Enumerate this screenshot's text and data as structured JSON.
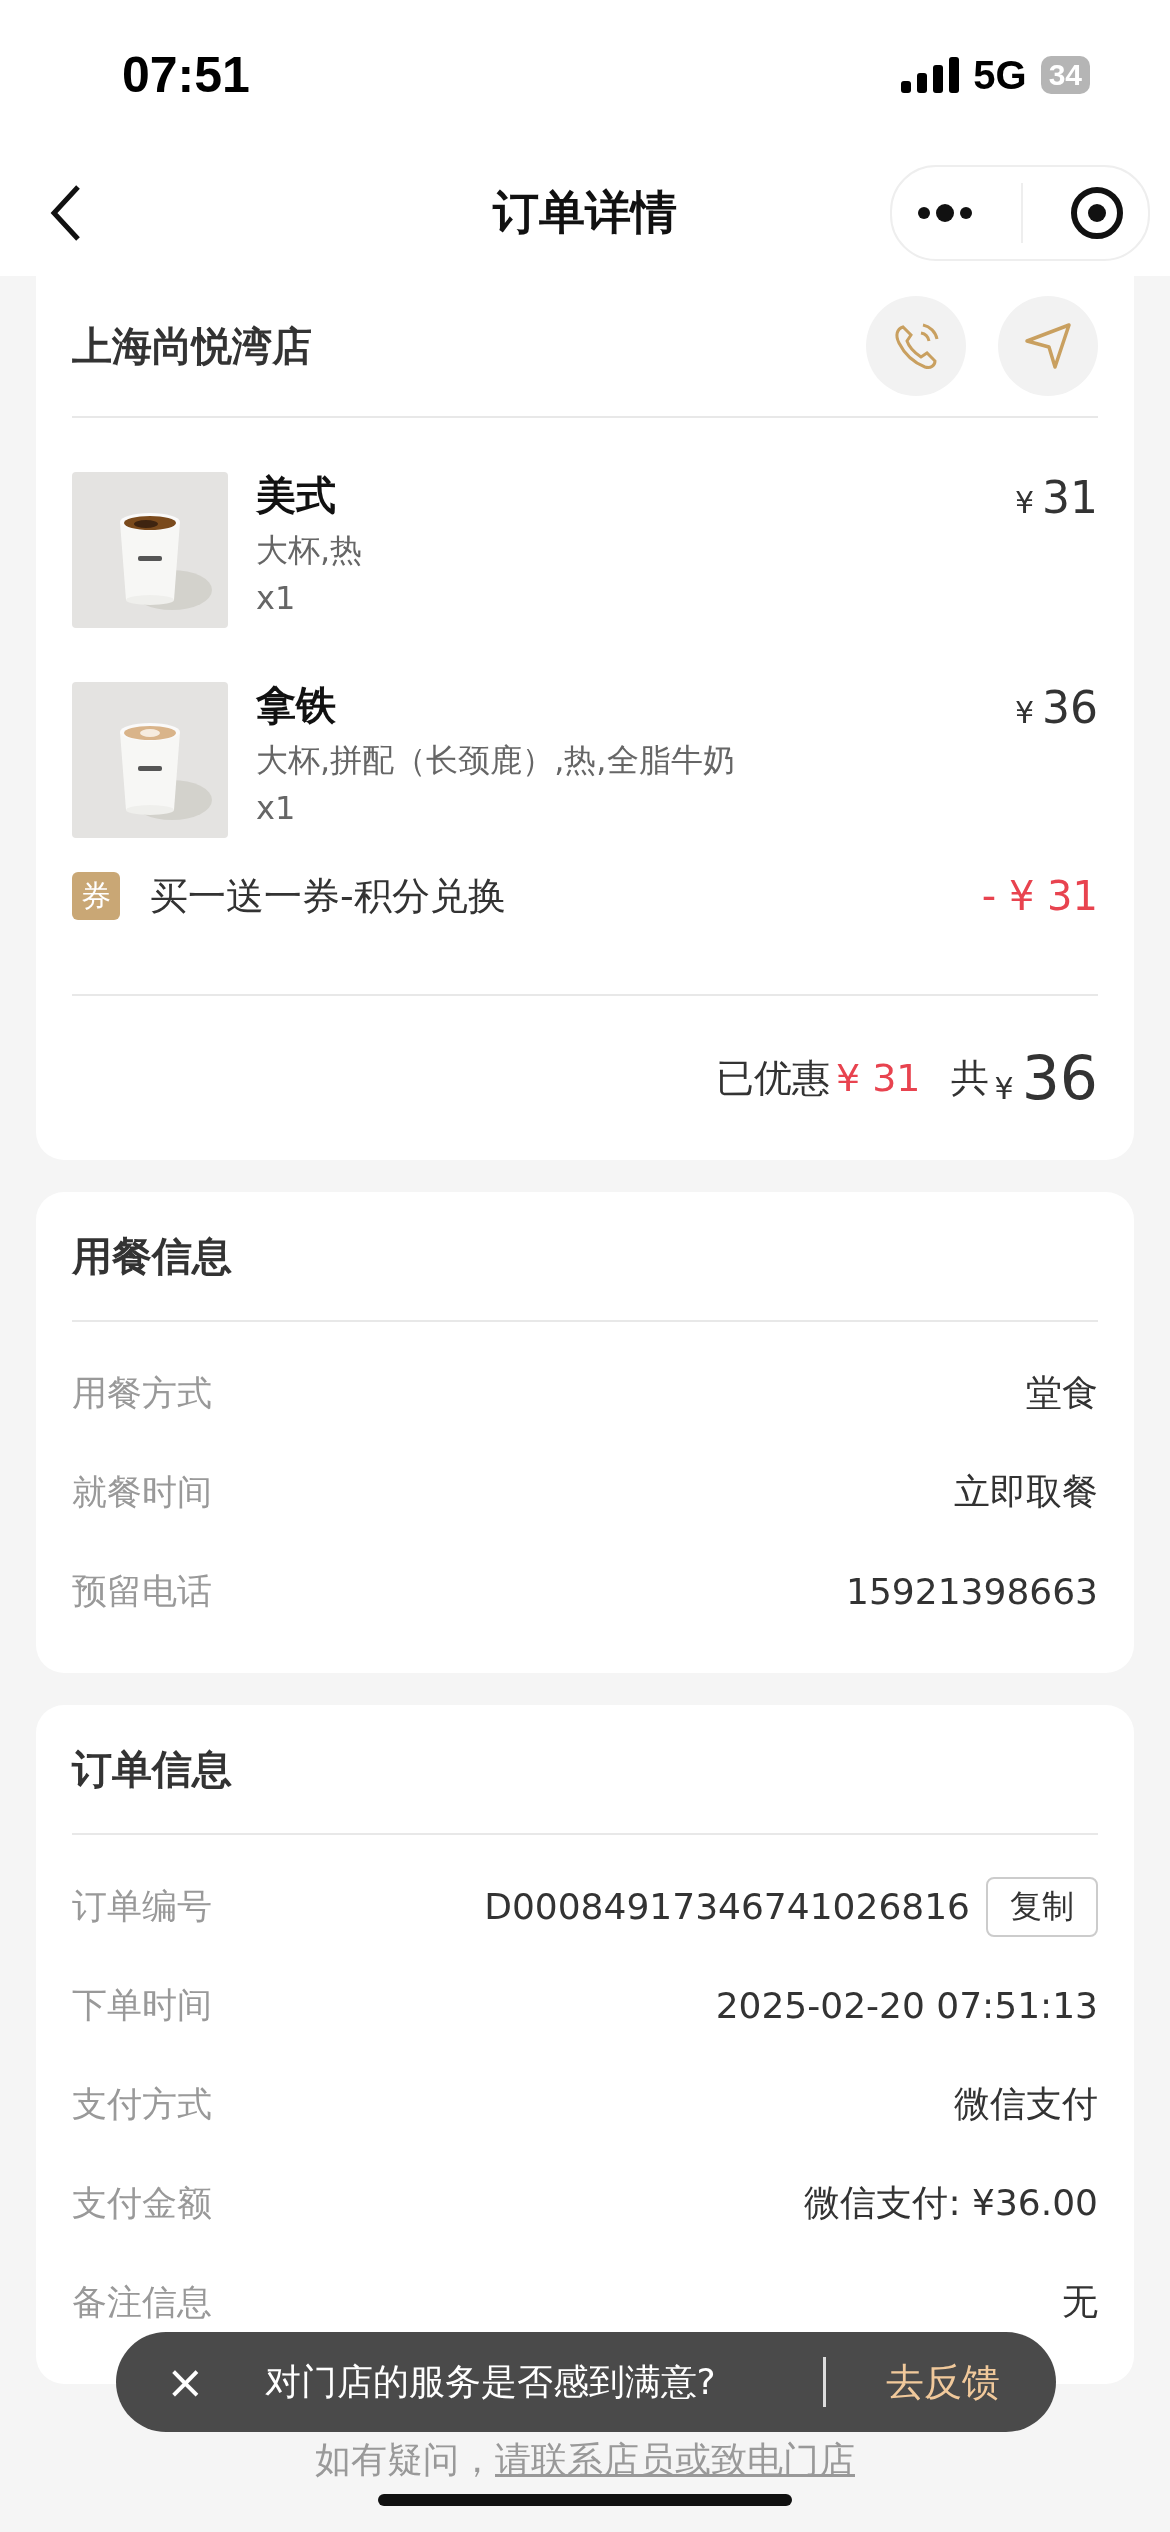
{
  "status_bar": {
    "time": "07:51",
    "network": "5G",
    "battery": "34"
  },
  "nav": {
    "title": "订单详情"
  },
  "store": {
    "name": "上海尚悦湾店"
  },
  "items": [
    {
      "name": "美式",
      "spec": "大杯,热",
      "qty": "x1",
      "currency": "¥",
      "price": "31",
      "kind": "picture"
    },
    {
      "name": "拿铁",
      "spec": "大杯,拼配（长颈鹿）,热,全脂牛奶",
      "qty": "x1",
      "currency": "¥",
      "price": "36",
      "kind": "picture"
    }
  ],
  "coupon": {
    "badge": "券",
    "label": "买一送一券-积分兑换",
    "sign": "-",
    "currency": "¥",
    "amount": "31"
  },
  "summary": {
    "discount_label": "已优惠",
    "discount_currency": "¥",
    "discount": "31",
    "total_label": "共",
    "total_currency": "¥",
    "total": "36"
  },
  "dining": {
    "title": "用餐信息",
    "rows": [
      {
        "label": "用餐方式",
        "value": "堂食",
        "kind": "text"
      },
      {
        "label": "就餐时间",
        "value": "立即取餐",
        "kind": "text"
      },
      {
        "label": "预留电话",
        "value": "15921398663",
        "kind": "text"
      }
    ]
  },
  "order": {
    "title": "订单信息",
    "rows": [
      {
        "label": "订单编号",
        "value": "D00084917346741026816",
        "kind": "copy",
        "button": "复制"
      },
      {
        "label": "下单时间",
        "value": "2025-02-20 07:51:13",
        "kind": "text"
      },
      {
        "label": "支付方式",
        "value": "微信支付",
        "kind": "text"
      },
      {
        "label": "支付金额",
        "value": "微信支付: ¥36.00",
        "kind": "text"
      },
      {
        "label": "备注信息",
        "value": "无",
        "kind": "text"
      }
    ]
  },
  "toast": {
    "close": "×",
    "message": "对门店的服务是否感到满意?",
    "action": "去反馈"
  },
  "footer": {
    "text": "如有疑问，",
    "link": "请联系店员或致电门店"
  }
}
